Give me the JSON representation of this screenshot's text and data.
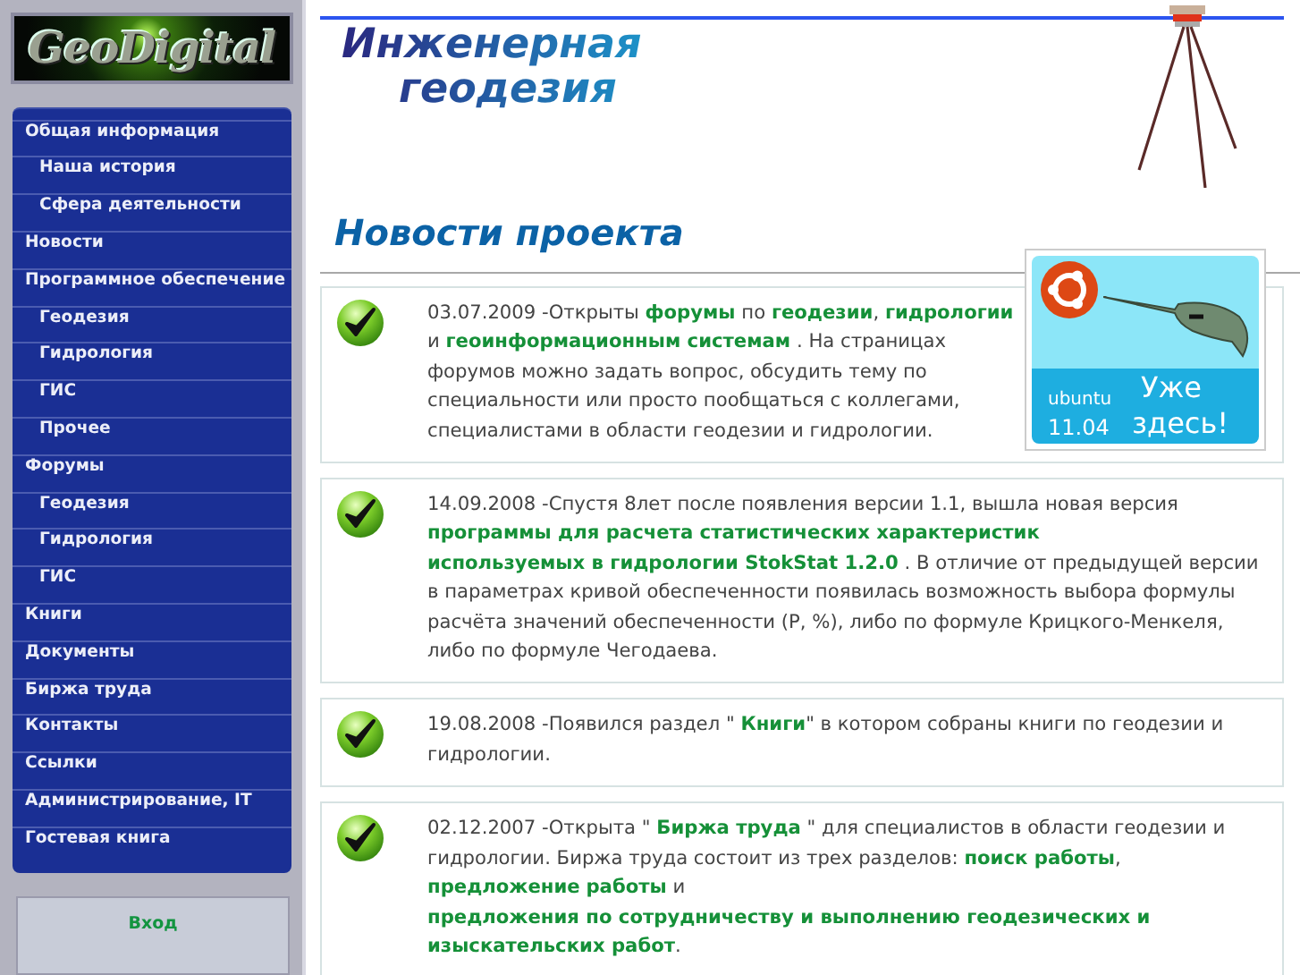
{
  "logo": {
    "text": "GeoDigital"
  },
  "sidebar": {
    "items": [
      {
        "label": "Общая информация",
        "children": [
          {
            "label": "Наша история"
          },
          {
            "label": "Сфера деятельности"
          }
        ]
      },
      {
        "label": "Новости"
      },
      {
        "label": "Программное обеспечение",
        "children": [
          {
            "label": "Геодезия"
          },
          {
            "label": "Гидрология"
          },
          {
            "label": "ГИС"
          },
          {
            "label": "Прочее"
          }
        ]
      },
      {
        "label": "Форумы",
        "children": [
          {
            "label": "Геодезия"
          },
          {
            "label": "Гидрология"
          },
          {
            "label": "ГИС"
          }
        ]
      },
      {
        "label": "Книги"
      },
      {
        "label": "Документы"
      },
      {
        "label": "Биржа труда"
      },
      {
        "label": "Контакты"
      },
      {
        "label": "Ссылки"
      },
      {
        "label": "Администрирование, IT"
      },
      {
        "label": "Гостевая книга"
      }
    ]
  },
  "login": {
    "title": "Вход"
  },
  "header": {
    "title_lines": [
      "Инженерная",
      "геодезия"
    ]
  },
  "page_title": "Новости проекта",
  "badge": {
    "brand": "ubuntu",
    "version": "11.04",
    "slogan_lines": [
      "Уже",
      "здесь!"
    ]
  },
  "news": [
    {
      "date": "03.07.2009",
      "segments": [
        {
          "text": " -Открыты ",
          "kind": "text"
        },
        {
          "text": "форумы",
          "kind": "link"
        },
        {
          "text": " по ",
          "kind": "text"
        },
        {
          "text": "геодезии",
          "kind": "link"
        },
        {
          "text": ", ",
          "kind": "text"
        },
        {
          "text": "гидрологии",
          "kind": "link"
        },
        {
          "text": " и ",
          "kind": "text"
        },
        {
          "text": "геоинформационным системам",
          "kind": "link"
        },
        {
          "text": " . На страницах форумов можно задать вопрос, обсудить тему по специальности или просто пообщаться с коллегами, специалистами в области геодезии и гидрологии.",
          "kind": "text"
        }
      ]
    },
    {
      "date": "14.09.2008",
      "segments": [
        {
          "text": " -Спустя 8лет после появления версии 1.1, вышла новая версия ",
          "kind": "text"
        },
        {
          "text": "программы для расчета статистических характеристик",
          "kind": "link"
        },
        {
          "text": "используемых в гидрологии StokStat 1.2.0",
          "kind": "link"
        },
        {
          "text": " . В отличие от предыдущей версии в параметрах кривой обеспеченности появилась возможность выбора формулы расчёта значений обеспеченности (P, %), либо по формуле Крицкого-Менкеля, либо по формуле Чегодаева.",
          "kind": "text"
        }
      ]
    },
    {
      "date": "19.08.2008",
      "segments": [
        {
          "text": " -Появился раздел \" ",
          "kind": "text"
        },
        {
          "text": "Книги",
          "kind": "link"
        },
        {
          "text": "\" в котором собраны книги по геодезии и гидрологии.",
          "kind": "text"
        }
      ]
    },
    {
      "date": "02.12.2007",
      "segments": [
        {
          "text": " -Открыта \" ",
          "kind": "text"
        },
        {
          "text": "Биржа труда",
          "kind": "link"
        },
        {
          "text": " \" для специалистов в области геодезии и гидрологии. Биржа труда состоит из трех разделов: ",
          "kind": "text"
        },
        {
          "text": "поиск работы",
          "kind": "link"
        },
        {
          "text": ", ",
          "kind": "text"
        },
        {
          "text": "предложение",
          "kind": "link"
        },
        {
          "text": "работы",
          "kind": "link"
        },
        {
          "text": " и ",
          "kind": "text"
        },
        {
          "text": "предложения по сотрудничеству и выполнению геодезических и",
          "kind": "link"
        },
        {
          "text": "изыскательских работ",
          "kind": "link"
        },
        {
          "text": ".",
          "kind": "text"
        }
      ]
    }
  ]
}
